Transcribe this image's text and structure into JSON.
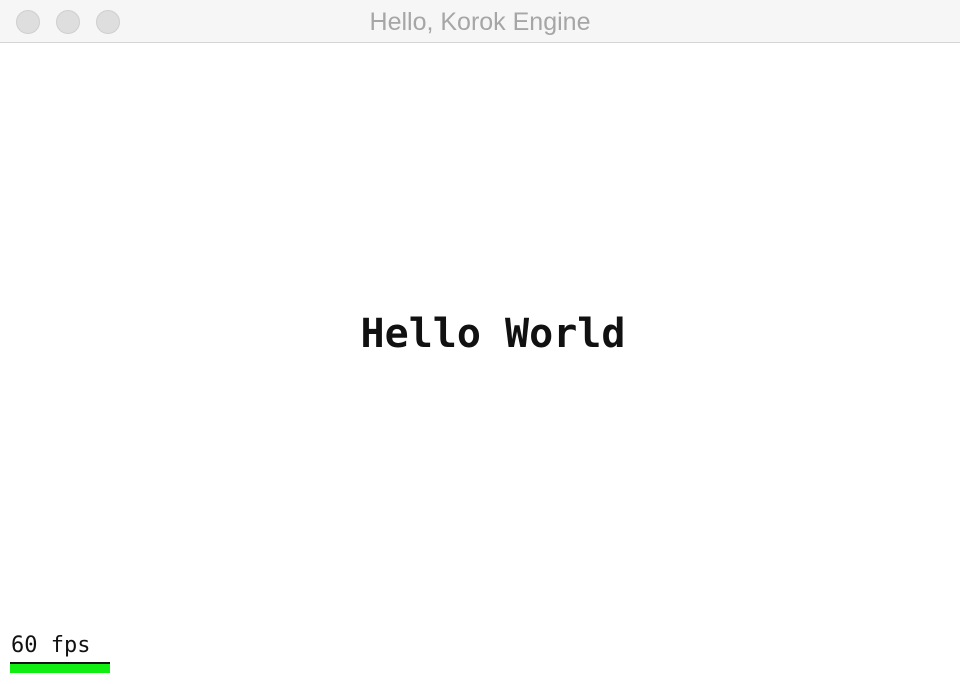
{
  "window": {
    "title": "Hello, Korok Engine",
    "controls": {
      "close": "close-button",
      "minimize": "minimize-button",
      "zoom": "zoom-button"
    }
  },
  "scene": {
    "text": "Hello World"
  },
  "stats": {
    "fps_label": "60 fps",
    "fps_bar_fraction": 1.0,
    "fps_bar_color": "#11ee11"
  }
}
